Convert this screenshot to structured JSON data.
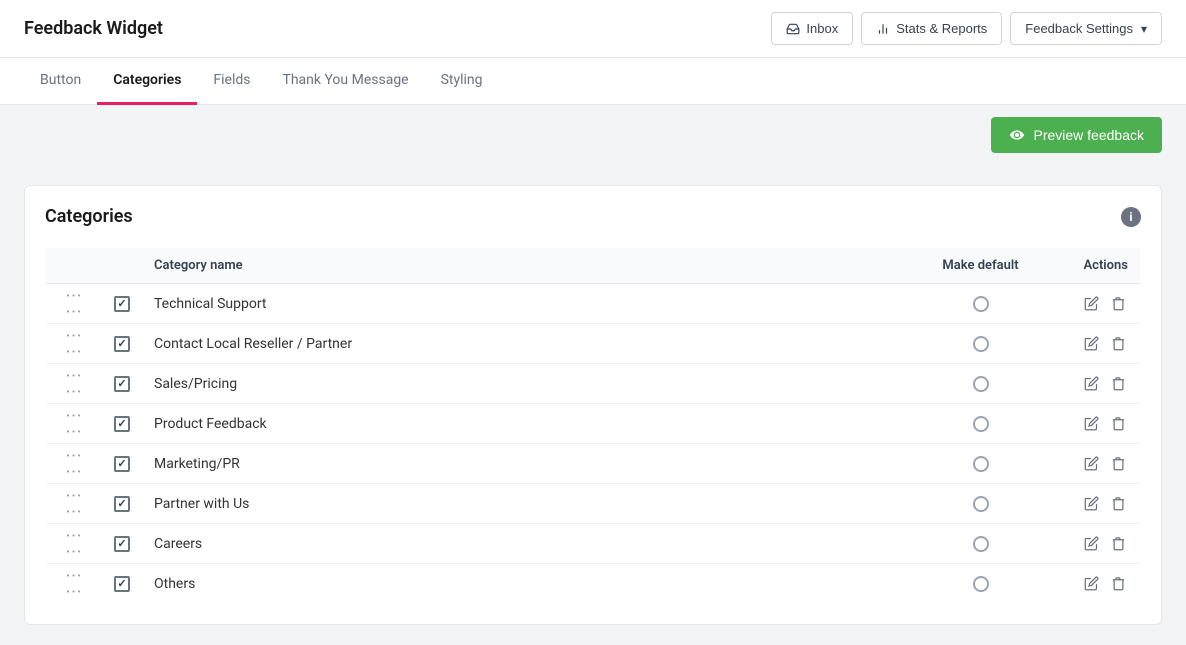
{
  "app": {
    "title": "Feedback Widget"
  },
  "header": {
    "inbox_label": "Inbox",
    "stats_label": "Stats & Reports",
    "settings_label": "Feedback Settings"
  },
  "tabs": [
    {
      "id": "button",
      "label": "Button",
      "active": false
    },
    {
      "id": "categories",
      "label": "Categories",
      "active": true
    },
    {
      "id": "fields",
      "label": "Fields",
      "active": false
    },
    {
      "id": "thank-you",
      "label": "Thank You Message",
      "active": false
    },
    {
      "id": "styling",
      "label": "Styling",
      "active": false
    }
  ],
  "toolbar": {
    "preview_label": "Preview feedback"
  },
  "categories": {
    "title": "Categories",
    "table": {
      "col_name": "Category name",
      "col_default": "Make default",
      "col_actions": "Actions"
    },
    "rows": [
      {
        "id": 1,
        "name": "Technical Support",
        "checked": true,
        "is_default": false
      },
      {
        "id": 2,
        "name": "Contact Local Reseller / Partner",
        "checked": true,
        "is_default": false
      },
      {
        "id": 3,
        "name": "Sales/Pricing",
        "checked": true,
        "is_default": false
      },
      {
        "id": 4,
        "name": "Product Feedback",
        "checked": true,
        "is_default": false
      },
      {
        "id": 5,
        "name": "Marketing/PR",
        "checked": true,
        "is_default": false
      },
      {
        "id": 6,
        "name": "Partner with Us",
        "checked": true,
        "is_default": false
      },
      {
        "id": 7,
        "name": "Careers",
        "checked": true,
        "is_default": false
      },
      {
        "id": 8,
        "name": "Others",
        "checked": true,
        "is_default": false
      }
    ]
  },
  "colors": {
    "active_tab_underline": "#e91e63",
    "preview_btn_bg": "#4caf50",
    "info_icon_bg": "#6b7280"
  }
}
